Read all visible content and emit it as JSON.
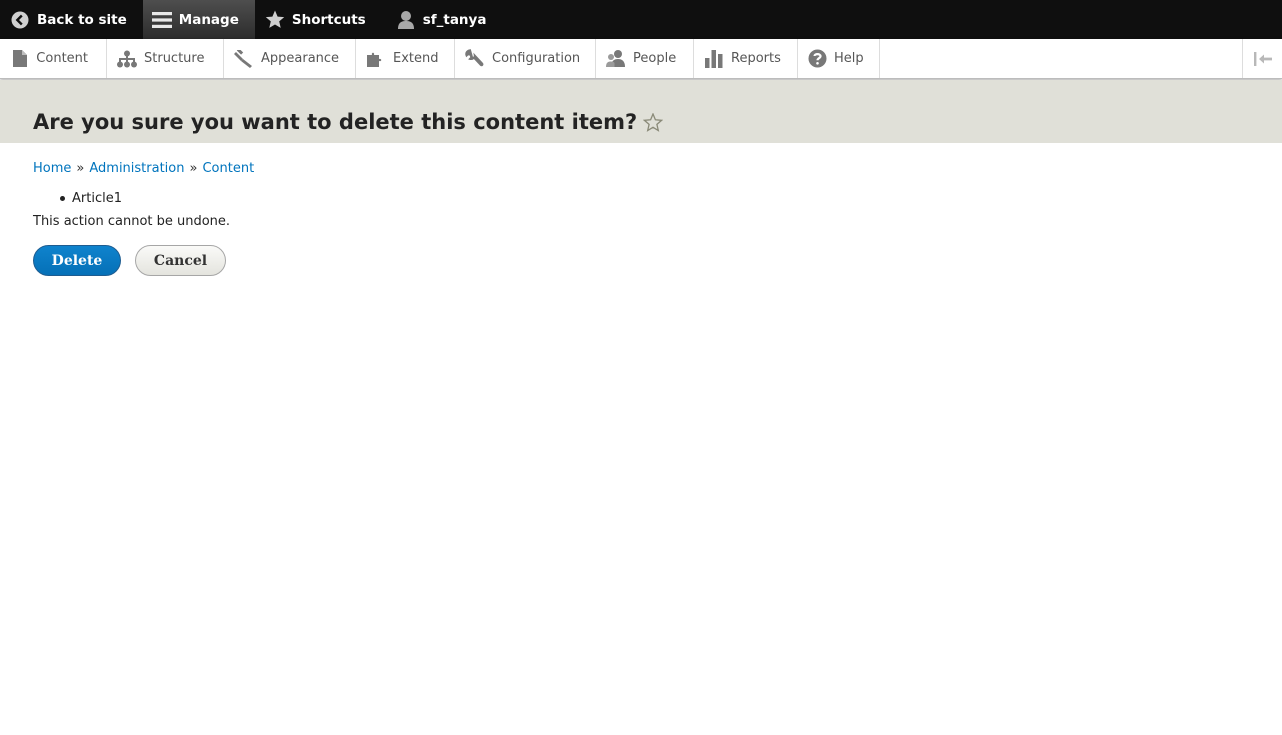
{
  "toolbar": {
    "back_to_site": "Back to site",
    "manage": "Manage",
    "shortcuts": "Shortcuts",
    "user": "sf_tanya"
  },
  "tray": {
    "items": [
      {
        "label": "Content",
        "icon": "file-icon"
      },
      {
        "label": "Structure",
        "icon": "sitemap-icon"
      },
      {
        "label": "Appearance",
        "icon": "paintbrush-icon"
      },
      {
        "label": "Extend",
        "icon": "puzzle-icon"
      },
      {
        "label": "Configuration",
        "icon": "wrench-icon"
      },
      {
        "label": "People",
        "icon": "people-icon"
      },
      {
        "label": "Reports",
        "icon": "bar-chart-icon"
      },
      {
        "label": "Help",
        "icon": "help-icon"
      }
    ]
  },
  "page": {
    "title": "Are you sure you want to delete this content item?"
  },
  "breadcrumb": {
    "items": [
      "Home",
      "Administration",
      "Content"
    ],
    "separator": "»"
  },
  "content": {
    "items": [
      "Article1"
    ],
    "description": "This action cannot be undone."
  },
  "actions": {
    "delete": "Delete",
    "cancel": "Cancel"
  },
  "colors": {
    "toolbar_bg": "#0f0f0f",
    "header_bg": "#e0e0d8",
    "link": "#0074bd",
    "primary_button": "#0570b7"
  }
}
